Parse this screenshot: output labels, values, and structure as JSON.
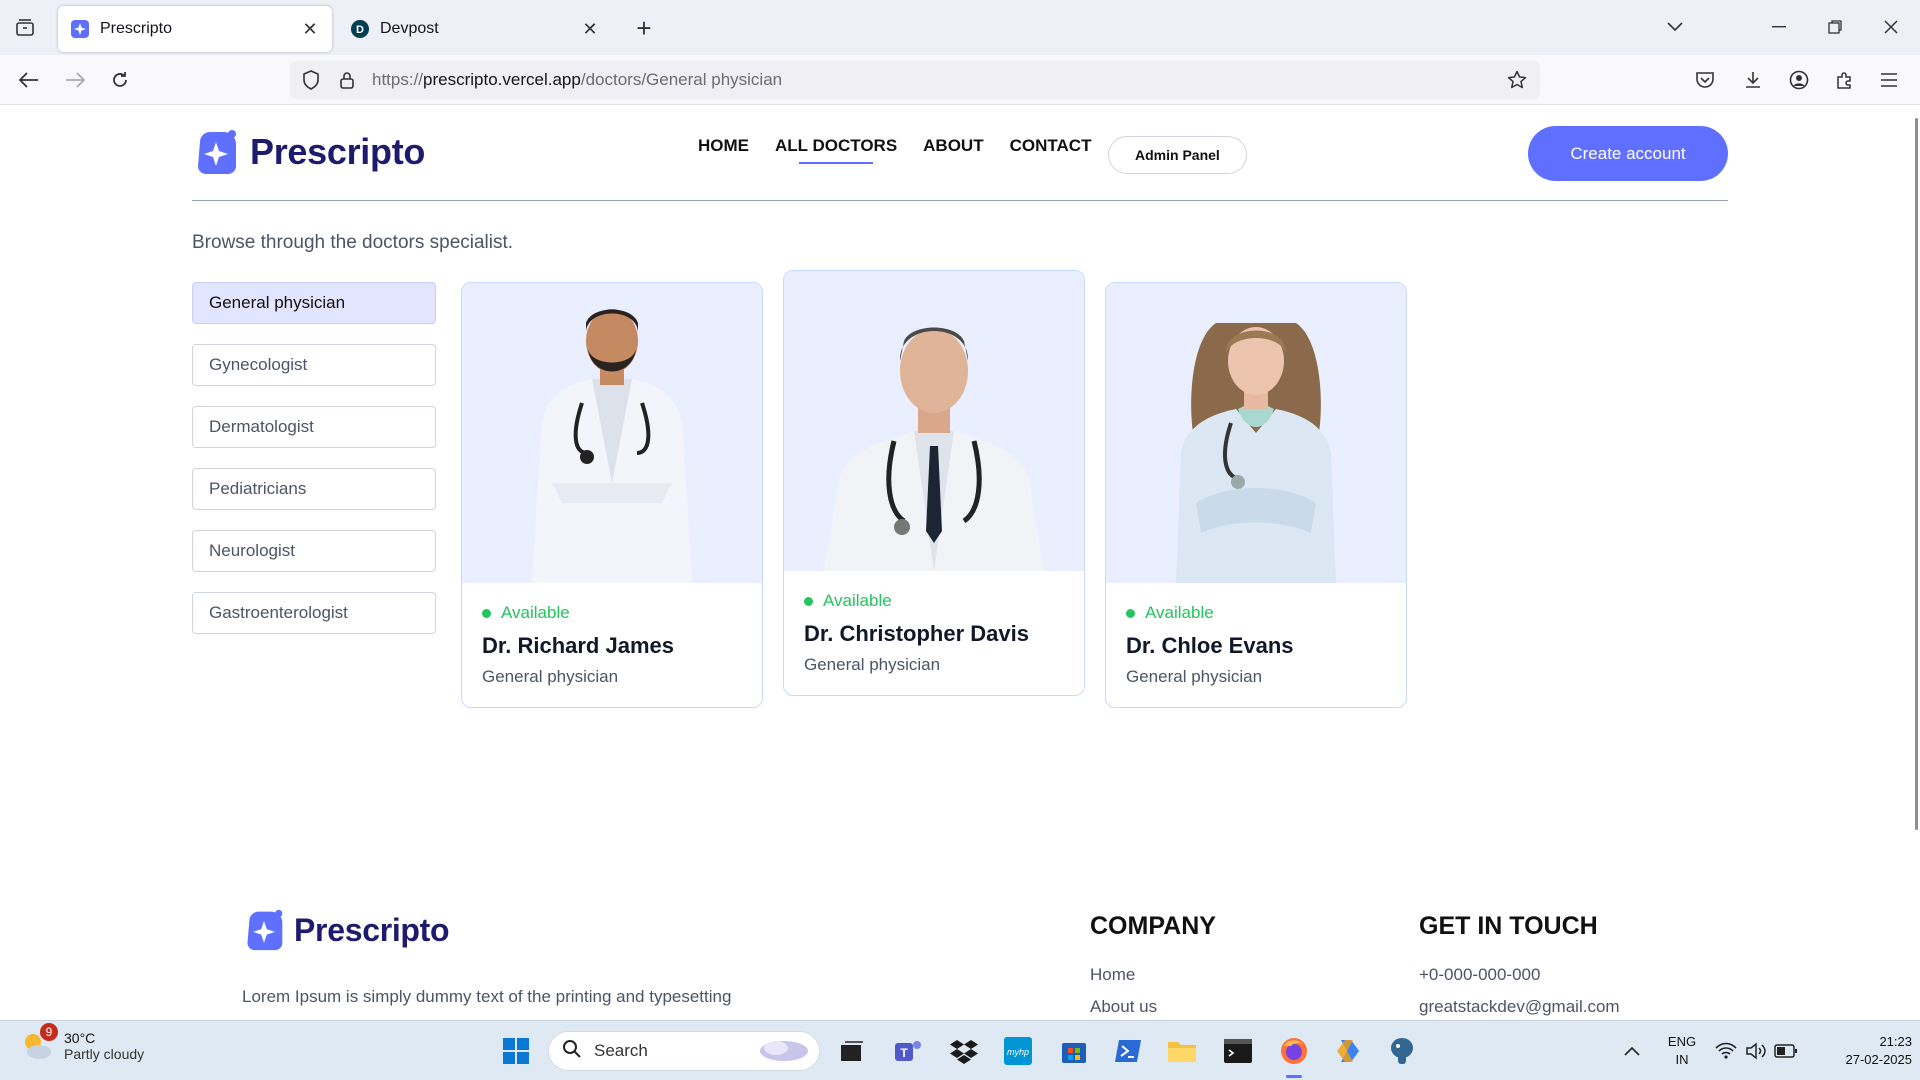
{
  "browser": {
    "tabs": [
      {
        "title": "Prescripto",
        "active": true
      },
      {
        "title": "Devpost",
        "active": false
      }
    ],
    "url_scheme": "https://",
    "url_host": "prescripto.vercel.app",
    "url_path": "/doctors/General physician"
  },
  "header": {
    "logo_text": "Prescripto",
    "nav": [
      "HOME",
      "ALL DOCTORS",
      "ABOUT",
      "CONTACT"
    ],
    "admin_label": "Admin Panel",
    "cta_label": "Create account"
  },
  "main": {
    "browse_text": "Browse through the doctors specialist.",
    "specialities": [
      "General physician",
      "Gynecologist",
      "Dermatologist",
      "Pediatricians",
      "Neurologist",
      "Gastroenterologist"
    ],
    "selected": "General physician",
    "doctors": [
      {
        "status": "Available",
        "name": "Dr. Richard James",
        "speciality": "General physician"
      },
      {
        "status": "Available",
        "name": "Dr. Christopher Davis",
        "speciality": "General physician"
      },
      {
        "status": "Available",
        "name": "Dr. Chloe Evans",
        "speciality": "General physician"
      }
    ]
  },
  "footer": {
    "logo_text": "Prescripto",
    "description": "Lorem Ipsum is simply dummy text of the printing and typesetting industry. Lorem Ipsum has been the industry's standard dummy",
    "company_title": "COMPANY",
    "company_links": [
      "Home",
      "About us"
    ],
    "contact_title": "GET IN TOUCH",
    "contact_lines": [
      "+0-000-000-000",
      "greatstackdev@gmail.com"
    ]
  },
  "taskbar": {
    "temperature": "30°C",
    "condition": "Partly cloudy",
    "weather_badge": "9",
    "search_label": "Search",
    "lang_top": "ENG",
    "lang_bottom": "IN",
    "time": "21:23",
    "date": "27-02-2025"
  },
  "colors": {
    "primary": "#5f6fff",
    "brand_text": "#1e1b6e",
    "available": "#22c55e",
    "card_bg": "#eaefff",
    "selected_filter": "#e2e5ff"
  }
}
